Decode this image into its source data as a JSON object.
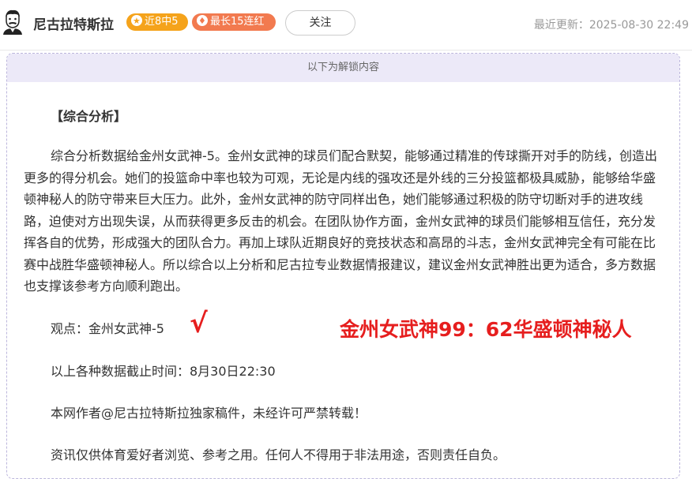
{
  "header": {
    "author_name": "尼古拉特斯拉",
    "badge_streak": "近8中5",
    "badge_best": "最长15连红",
    "follow_label": "关注",
    "updated_label": "最近更新：",
    "updated_time": "2025-08-30 22:49",
    "avatar_icon": "avatar-portrait-icon",
    "badge_streak_icon": "star-icon",
    "badge_best_icon": "flame-icon"
  },
  "content": {
    "locked_banner": "以下为解锁内容",
    "section_title": "【综合分析】",
    "analysis_text": "综合分析数据给金州女武神-5。金州女武神的球员们配合默契，能够通过精准的传球撕开对手的防线，创造出更多的得分机会。她们的投篮命中率也较为可观，无论是内线的强攻还是外线的三分投篮都极具威胁，能够给华盛顿神秘人的防守带来巨大压力。此外，金州女武神的防守同样出色，她们能够通过积极的防守切断对手的进攻线路，迫使对方出现失误，从而获得更多反击的机会。在团队协作方面，金州女武神的球员们能够相互信任，充分发挥各自的优势，形成强大的团队合力。再加上球队近期良好的竞技状态和高昂的斗志，金州女武神完全有可能在比赛中战胜华盛顿神秘人。所以综合以上分析和尼古拉专业数据情报建议，建议金州女武神胜出更为适合，多方数据也支撑该参考方向顺利跑出。",
    "viewpoint": "观点：金州女武神-5",
    "checkmark": "√",
    "score_result": "金州女武神99：62华盛顿神秘人",
    "deadline": "以上各种数据截止时间：8月30日22:30",
    "copyright": "本网作者@尼古拉特斯拉独家稿件，未经许可严禁转载！",
    "disclaimer": "资讯仅供体育爱好者浏览、参考之用。任何人不得用于非法用途，否则责任自负。"
  },
  "colors": {
    "accent_red": "#e61e1e",
    "badge_orange": "#f5a31b",
    "badge_coral": "#f27a4f",
    "banner_lavender": "#ece9f8"
  }
}
